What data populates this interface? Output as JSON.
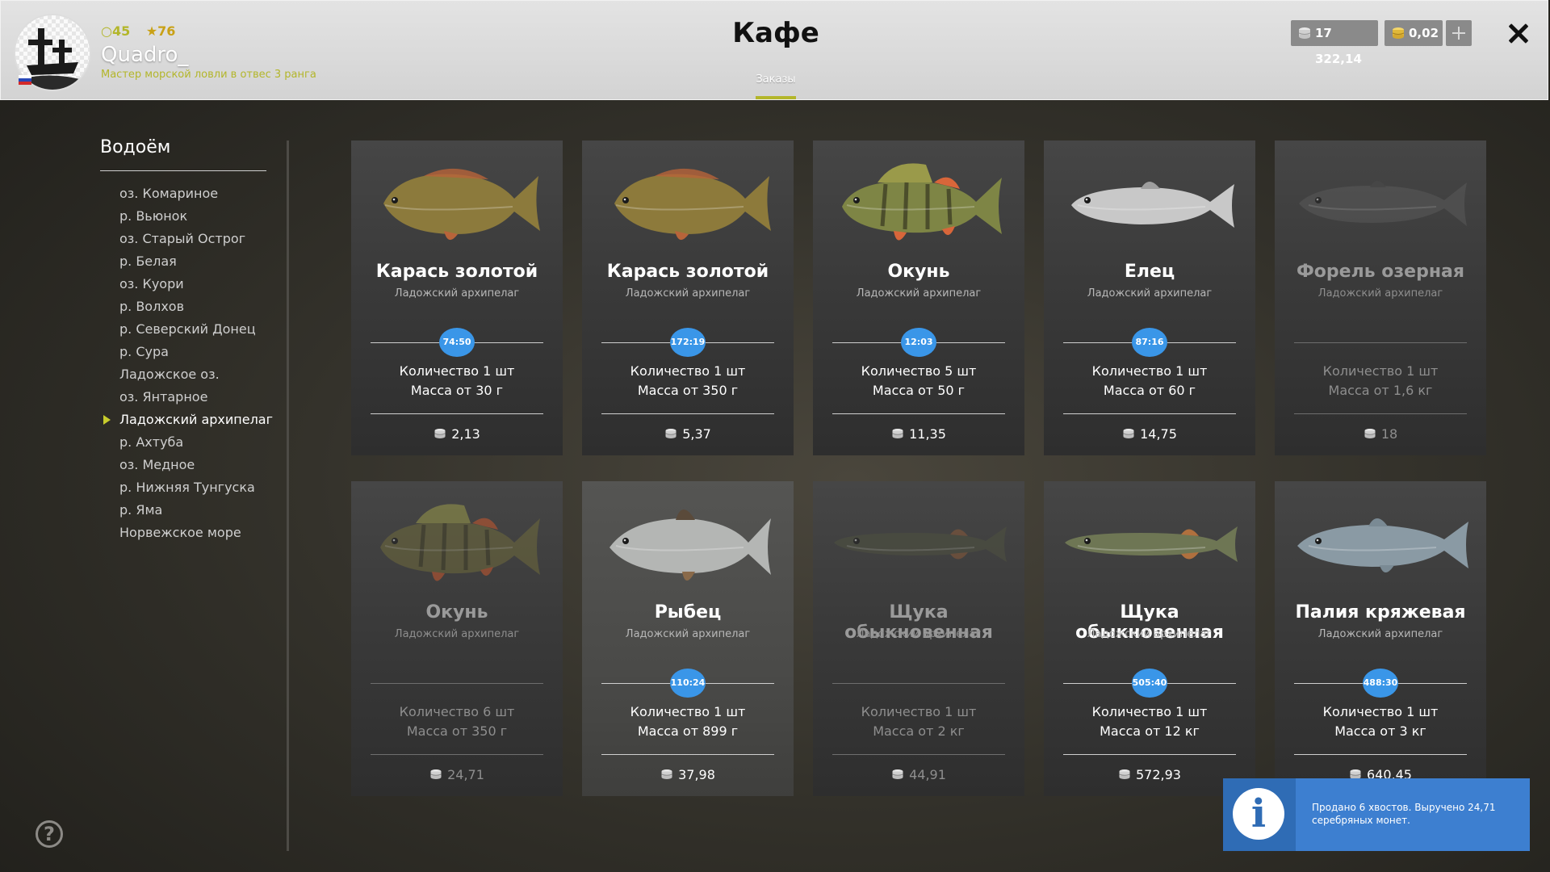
{
  "user": {
    "level": "45",
    "rank_points": "76",
    "name": "Quadro_",
    "title": "Мастер морской ловли в отвес 3 ранга"
  },
  "header": {
    "title": "Кафе",
    "tab": "Заказы",
    "silver": "17 322,14",
    "gold": "0,02"
  },
  "sidebar": {
    "title": "Водоём",
    "items": [
      {
        "label": "оз. Комариное"
      },
      {
        "label": "р. Вьюнок"
      },
      {
        "label": "оз. Старый Острог"
      },
      {
        "label": "р. Белая"
      },
      {
        "label": "оз. Куори"
      },
      {
        "label": "р. Волхов"
      },
      {
        "label": "р. Северский Донец"
      },
      {
        "label": "р. Сура"
      },
      {
        "label": "Ладожское оз."
      },
      {
        "label": "оз. Янтарное"
      },
      {
        "label": "Ладожский архипелаг",
        "active": true
      },
      {
        "label": "р. Ахтуба"
      },
      {
        "label": "оз. Медное"
      },
      {
        "label": "р. Нижняя Тунгуска"
      },
      {
        "label": "р. Яма"
      },
      {
        "label": "Норвежское море"
      }
    ]
  },
  "orders": [
    {
      "name": "Карась золотой",
      "location": "Ладожский архипелаг",
      "timer": "74:50",
      "quantity": "Количество 1 шт",
      "mass": "Масса от 30 г",
      "price": "2,13",
      "fish": "crucian",
      "body": "#8c7a3c",
      "fin": "#b8643a",
      "dim": false
    },
    {
      "name": "Карась золотой",
      "location": "Ладожский архипелаг",
      "timer": "172:19",
      "quantity": "Количество 1 шт",
      "mass": "Масса от 350 г",
      "price": "5,37",
      "fish": "crucian",
      "body": "#8d7a3b",
      "fin": "#b8643a",
      "dim": false
    },
    {
      "name": "Окунь",
      "location": "Ладожский архипелаг",
      "timer": "12:03",
      "quantity": "Количество 5 шт",
      "mass": "Масса от 50 г",
      "price": "11,35",
      "fish": "perch",
      "body": "#7e8545",
      "fin": "#d8663a",
      "dim": false
    },
    {
      "name": "Елец",
      "location": "Ладожский архипелаг",
      "timer": "87:16",
      "quantity": "Количество 1 шт",
      "mass": "Масса от 60 г",
      "price": "14,75",
      "fish": "dace",
      "body": "#c8c8c8",
      "fin": "#9e9e9e",
      "dim": false
    },
    {
      "name": "Форель озерная",
      "location": "Ладожский архипелаг",
      "timer": "",
      "quantity": "Количество 1 шт",
      "mass": "Масса от 1,6 кг",
      "price": "18",
      "fish": "trout",
      "body": "#5a5a5a",
      "fin": "#4a4a4a",
      "dim": true
    },
    {
      "name": "Окунь",
      "location": "Ладожский архипелаг",
      "timer": "",
      "quantity": "Количество 6 шт",
      "mass": "Масса от 350 г",
      "price": "24,71",
      "fish": "perch",
      "body": "#6f6a3c",
      "fin": "#c8582e",
      "dim": true
    },
    {
      "name": "Рыбец",
      "location": "Ладожский архипелаг",
      "timer": "110:24",
      "quantity": "Количество 1 шт",
      "mass": "Масса от 899 г",
      "price": "37,98",
      "fish": "vimba",
      "body": "#b4b6b4",
      "fin": "#8a6a4a",
      "dim": false,
      "highlight": true
    },
    {
      "name": "Щука обыкновенная",
      "location": "Ладожский архипелаг",
      "timer": "",
      "quantity": "Количество 1 шт",
      "mass": "Масса от 2 кг",
      "price": "44,91",
      "fish": "pike",
      "body": "#4f5240",
      "fin": "#8a5a3a",
      "dim": true
    },
    {
      "name": "Щука обыкновенная",
      "location": "Ладожский архипелаг",
      "timer": "505:40",
      "quantity": "Количество 1 шт",
      "mass": "Масса от 12 кг",
      "price": "572,93",
      "fish": "pike",
      "body": "#6e7654",
      "fin": "#b0703e",
      "dim": false
    },
    {
      "name": "Палия кряжевая",
      "location": "Ладожский архипелаг",
      "timer": "488:30",
      "quantity": "Количество 1 шт",
      "mass": "Масса от 3 кг",
      "price": "640,45",
      "fish": "char",
      "body": "#8a9aa4",
      "fin": "#7a8a94",
      "dim": false
    }
  ],
  "toast": {
    "text": "Продано 6 хвостов. Выручено 24,71 серебряных монет."
  },
  "help": "?"
}
